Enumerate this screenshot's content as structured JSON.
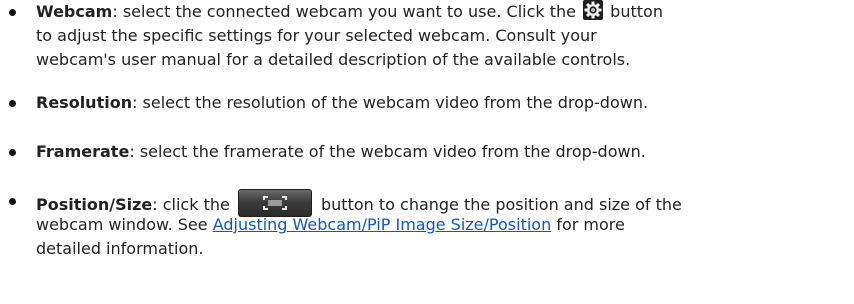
{
  "items": [
    {
      "term": "Webcam",
      "line1_before": ": select the connected webcam you want to use. Click the ",
      "line1_after": " button",
      "line2": "to adjust the specific settings for your selected webcam. Consult your",
      "line3": "webcam's user manual for a detailed description of the available controls.",
      "icon": "gear-icon"
    },
    {
      "term": "Resolution",
      "text": ": select the resolution of the webcam video from the drop-down."
    },
    {
      "term": "Framerate",
      "text": ": select the framerate of the webcam video from the drop-down."
    },
    {
      "term": "Position/Size",
      "line1_before": ": click the ",
      "line1_after": " button to change the position and size of the",
      "line2_before": "webcam window. See ",
      "link": "Adjusting Webcam/PiP Image Size/Position",
      "line2_after": " for more",
      "line3": "detailed information.",
      "icon": "fit-frame-icon"
    }
  ],
  "colors": {
    "text": "#222222",
    "link": "#1155cc"
  }
}
